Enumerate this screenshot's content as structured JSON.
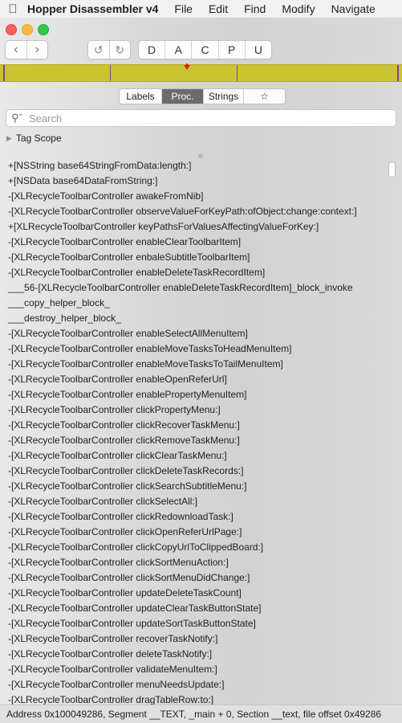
{
  "menubar": {
    "app_name": "Hopper Disassembler v4",
    "menus": [
      "File",
      "Edit",
      "Find",
      "Modify",
      "Navigate"
    ]
  },
  "toolbar": {
    "back_icon": "‹",
    "forward_icon": "›",
    "undo_icon": "↺",
    "redo_icon": "↻",
    "modes": [
      "D",
      "A",
      "C",
      "P",
      "U"
    ]
  },
  "colors": {
    "nav_strip": "#c9c430",
    "nav_strip_mark": "#8a3d93",
    "cursor_marker": "#e02020",
    "selected_segment": "#6b6b6b"
  },
  "segmented": {
    "labels": "Labels",
    "procedures": "Proc.",
    "strings": "Strings",
    "bookmarks": "☆"
  },
  "search": {
    "placeholder": "Search"
  },
  "tag_scope": {
    "label": "Tag Scope"
  },
  "procedures": [
    "+[NSString base64StringFromData:length:]",
    "+[NSData base64DataFromString:]",
    "-[XLRecycleToolbarController awakeFromNib]",
    "-[XLRecycleToolbarController observeValueForKeyPath:ofObject:change:context:]",
    "+[XLRecycleToolbarController keyPathsForValuesAffectingValueForKey:]",
    "-[XLRecycleToolbarController enableClearToolbarItem]",
    "-[XLRecycleToolbarController enbaleSubtitleToolbarItem]",
    "-[XLRecycleToolbarController enableDeleteTaskRecordItem]",
    "___56-[XLRecycleToolbarController enableDeleteTaskRecordItem]_block_invoke",
    "___copy_helper_block_",
    "___destroy_helper_block_",
    "-[XLRecycleToolbarController enableSelectAllMenuItem]",
    "-[XLRecycleToolbarController enableMoveTasksToHeadMenuItem]",
    "-[XLRecycleToolbarController enableMoveTasksToTailMenuItem]",
    "-[XLRecycleToolbarController enableOpenReferUrl]",
    "-[XLRecycleToolbarController enablePropertyMenuItem]",
    "-[XLRecycleToolbarController clickPropertyMenu:]",
    "-[XLRecycleToolbarController clickRecoverTaskMenu:]",
    "-[XLRecycleToolbarController clickRemoveTaskMenu:]",
    "-[XLRecycleToolbarController clickClearTaskMenu:]",
    "-[XLRecycleToolbarController clickDeleteTaskRecords:]",
    "-[XLRecycleToolbarController clickSearchSubtitleMenu:]",
    "-[XLRecycleToolbarController clickSelectAll:]",
    "-[XLRecycleToolbarController clickRedownloadTask:]",
    "-[XLRecycleToolbarController clickOpenReferUrlPage:]",
    "-[XLRecycleToolbarController clickCopyUrlToClippedBoard:]",
    "-[XLRecycleToolbarController clickSortMenuAction:]",
    "-[XLRecycleToolbarController clickSortMenuDidChange:]",
    "-[XLRecycleToolbarController updateDeleteTaskCount]",
    "-[XLRecycleToolbarController updateClearTaskButtonState]",
    "-[XLRecycleToolbarController updateSortTaskButtonState]",
    "-[XLRecycleToolbarController recoverTaskNotify:]",
    "-[XLRecycleToolbarController deleteTaskNotify:]",
    "-[XLRecycleToolbarController validateMenuItem:]",
    "-[XLRecycleToolbarController menuNeedsUpdate:]",
    "-[XLRecycleToolbarController dragTableRow:to:]"
  ],
  "status": {
    "text": "Address 0x100049286, Segment __TEXT, _main + 0, Section __text, file offset 0x49286"
  }
}
